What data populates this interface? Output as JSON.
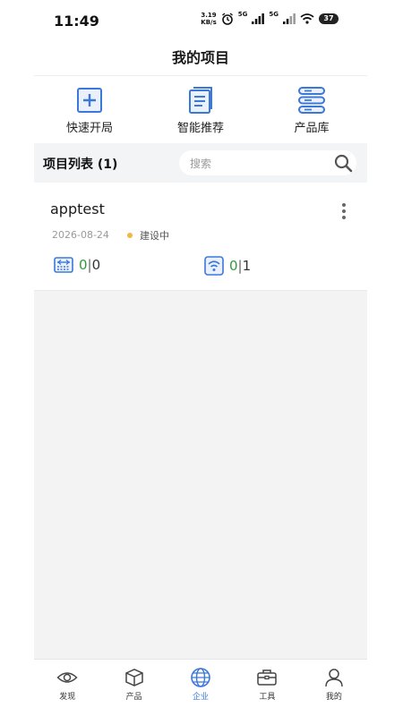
{
  "status_bar": {
    "time": "11:49",
    "speed_value": "3.19",
    "speed_unit": "KB/s",
    "net_1": "5G",
    "net_2": "5G",
    "battery": "37"
  },
  "header": {
    "title": "我的项目"
  },
  "actions": [
    {
      "label": "快速开局",
      "icon": "plus-square-icon"
    },
    {
      "label": "智能推荐",
      "icon": "document-icon"
    },
    {
      "label": "产品库",
      "icon": "server-stack-icon"
    }
  ],
  "list_header": {
    "title": "项目列表 (1)",
    "search_placeholder": "搜索"
  },
  "projects": [
    {
      "name": "apptest",
      "date": "2026-08-24",
      "status": "建设中",
      "status_color": "#f0b840",
      "stat_switch": {
        "a": "0",
        "sep": "|",
        "b": "0"
      },
      "stat_wifi": {
        "a": "0",
        "sep": "|",
        "b": "1"
      }
    }
  ],
  "tabs": [
    {
      "label": "发现",
      "icon": "eye-icon",
      "active": false
    },
    {
      "label": "产品",
      "icon": "box-icon",
      "active": false
    },
    {
      "label": "企业",
      "icon": "globe-icon",
      "active": true
    },
    {
      "label": "工具",
      "icon": "toolbox-icon",
      "active": false
    },
    {
      "label": "我的",
      "icon": "person-icon",
      "active": false
    }
  ],
  "colors": {
    "accent": "#3c78d8",
    "green": "#2e9b3a",
    "status_building": "#f0b840"
  }
}
